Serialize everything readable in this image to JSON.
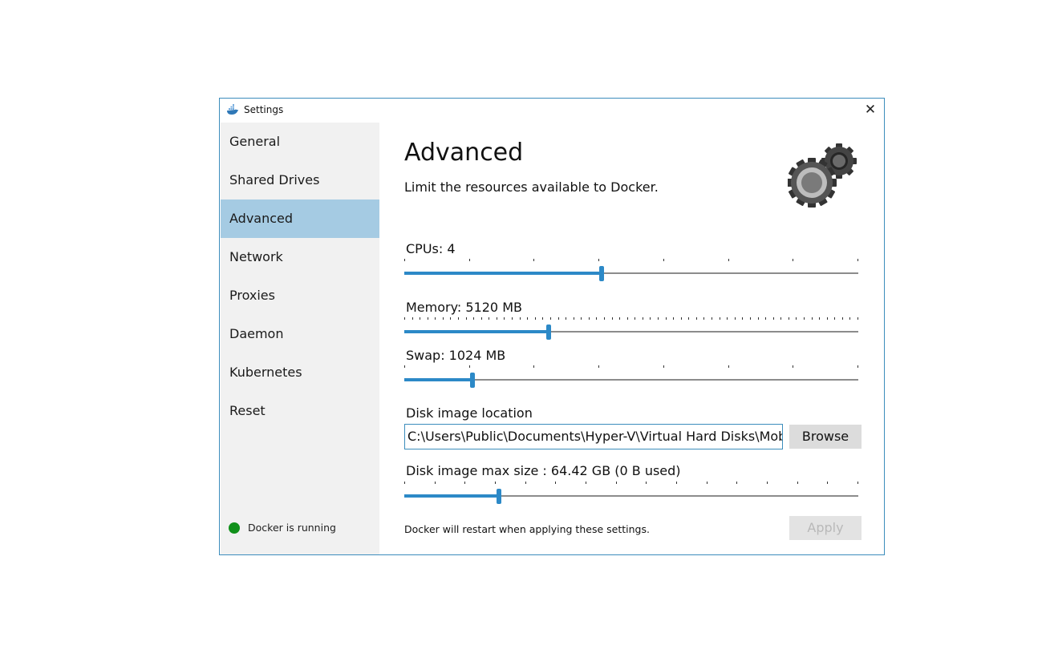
{
  "window": {
    "title": "Settings",
    "close_label": "✕"
  },
  "sidebar": {
    "items": [
      {
        "label": "General",
        "active": false
      },
      {
        "label": "Shared Drives",
        "active": false
      },
      {
        "label": "Advanced",
        "active": true
      },
      {
        "label": "Network",
        "active": false
      },
      {
        "label": "Proxies",
        "active": false
      },
      {
        "label": "Daemon",
        "active": false
      },
      {
        "label": "Kubernetes",
        "active": false
      },
      {
        "label": "Reset",
        "active": false
      }
    ],
    "status_text": "Docker is running",
    "status_color": "#10901a"
  },
  "main": {
    "title": "Advanced",
    "subtitle": "Limit the resources available to Docker.",
    "icon": "gears-icon",
    "cpus": {
      "label": "CPUs: 4",
      "value": 4,
      "min": 1,
      "max": 8,
      "tick_count": 8
    },
    "memory": {
      "label": "Memory: 5120 MB",
      "value_fraction": 0.318,
      "tick_count": 60
    },
    "swap": {
      "label": "Swap: 1024 MB",
      "value_fraction": 0.15,
      "tick_count": 8
    },
    "disk_location": {
      "label": "Disk image location",
      "value": "C:\\Users\\Public\\Documents\\Hyper-V\\Virtual Hard Disks\\MobyLinuxVM.vhdx",
      "browse_label": "Browse"
    },
    "disk_size": {
      "label": "Disk image max size :   64.42 GB (0 B  used)",
      "value_fraction": 0.208,
      "tick_count": 16
    },
    "footer_note": "Docker will restart when applying these settings.",
    "apply_label": "Apply",
    "accent_color": "#2c89c7"
  }
}
